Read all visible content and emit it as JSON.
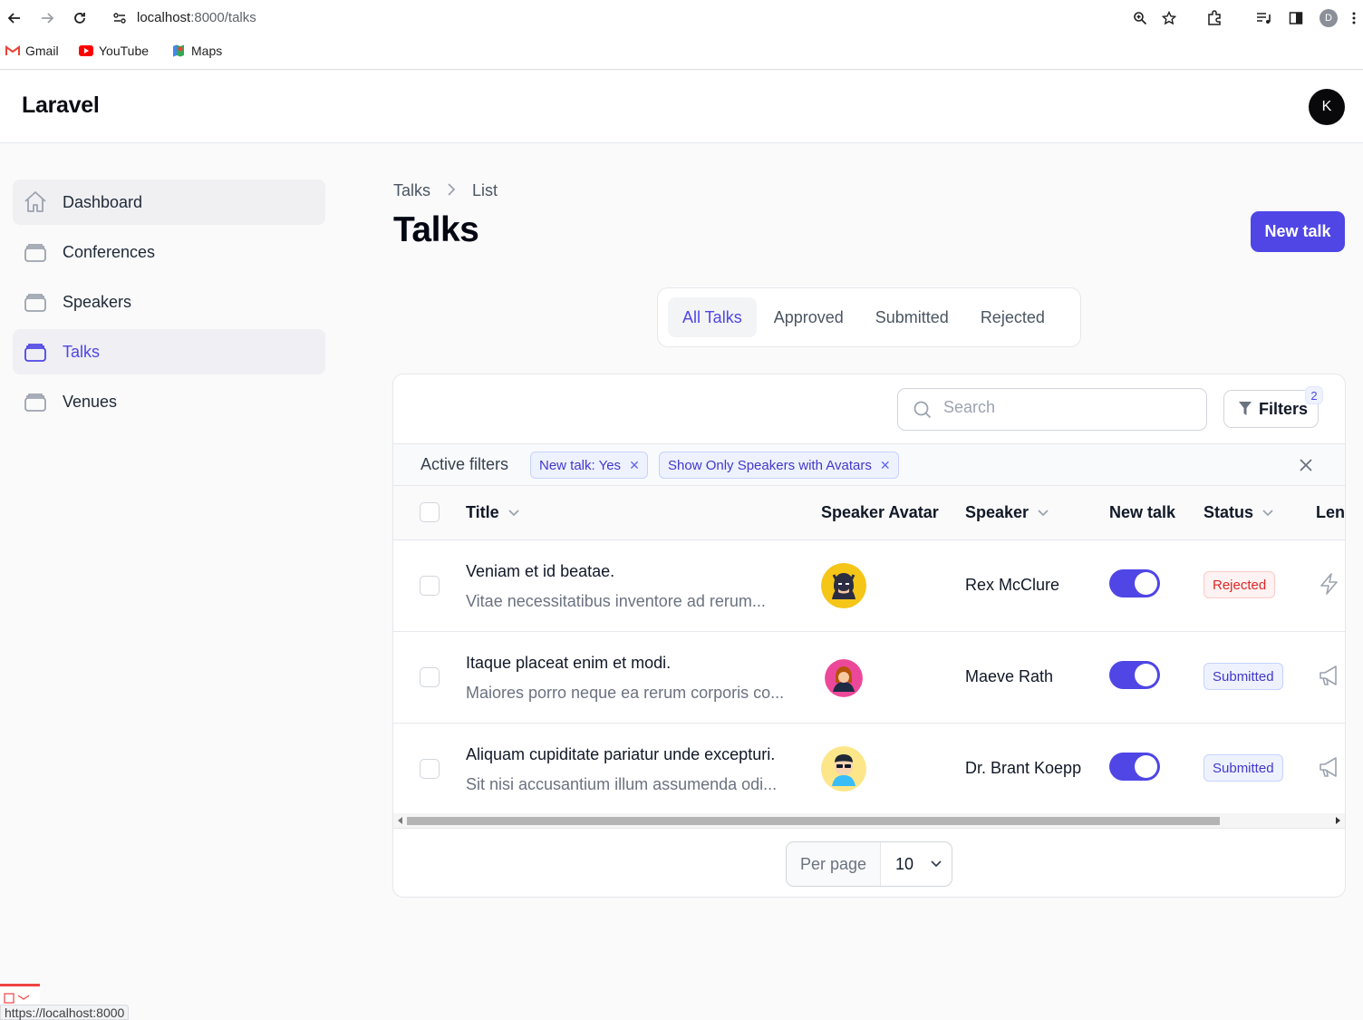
{
  "browser": {
    "url_host": "localhost",
    "url_path": ":8000/talks",
    "bookmarks": [
      "Gmail",
      "YouTube",
      "Maps"
    ],
    "status_url": "https://localhost:8000",
    "profile_initial": "D"
  },
  "header": {
    "brand": "Laravel",
    "user_initial": "K"
  },
  "sidebar": {
    "items": [
      {
        "label": "Dashboard"
      },
      {
        "label": "Conferences"
      },
      {
        "label": "Speakers"
      },
      {
        "label": "Talks",
        "active": true
      },
      {
        "label": "Venues"
      }
    ]
  },
  "breadcrumbs": [
    "Talks",
    "List"
  ],
  "page": {
    "title": "Talks",
    "new_button": "New talk"
  },
  "tabs": [
    "All Talks",
    "Approved",
    "Submitted",
    "Rejected"
  ],
  "toolbar": {
    "search_placeholder": "Search",
    "filters_label": "Filters",
    "filters_count": "2"
  },
  "active_filters": {
    "label": "Active filters",
    "chips": [
      "New talk: Yes",
      "Show Only Speakers with Avatars"
    ]
  },
  "table": {
    "columns": [
      "Title",
      "Speaker Avatar",
      "Speaker",
      "New talk",
      "Status",
      "Len"
    ],
    "rows": [
      {
        "title": "Veniam et id beatae.",
        "description": "Vitae necessitatibus inventore ad rerum...",
        "speaker": "Rex McClure",
        "new_talk": true,
        "status": "Rejected",
        "length_icon": "lightning-icon"
      },
      {
        "title": "Itaque placeat enim et modi.",
        "description": "Maiores porro neque ea rerum corporis co...",
        "speaker": "Maeve Rath",
        "new_talk": true,
        "status": "Submitted",
        "length_icon": "megaphone-icon"
      },
      {
        "title": "Aliquam cupiditate pariatur unde excepturi.",
        "description": "Sit nisi accusantium illum assumenda odi...",
        "speaker": "Dr. Brant Koepp",
        "new_talk": true,
        "status": "Submitted",
        "length_icon": "megaphone-icon"
      }
    ]
  },
  "pagination": {
    "per_page_label": "Per page",
    "per_page_value": "10"
  },
  "colors": {
    "primary": "#4f46e5",
    "danger": "#dc2626"
  }
}
